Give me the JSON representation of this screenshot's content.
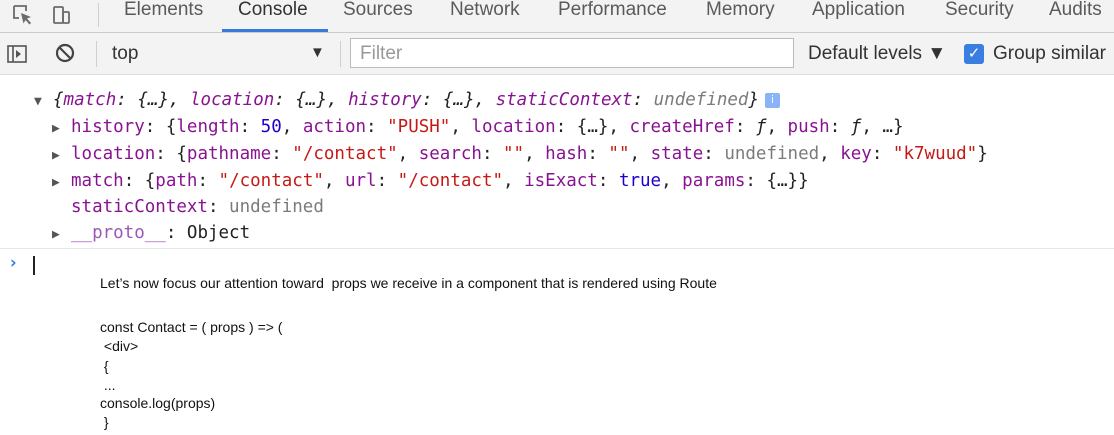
{
  "devtools": {
    "tabs": [
      {
        "label": "Elements"
      },
      {
        "label": "Console"
      },
      {
        "label": "Sources"
      },
      {
        "label": "Network"
      },
      {
        "label": "Performance"
      },
      {
        "label": "Memory"
      },
      {
        "label": "Application"
      },
      {
        "label": "Security"
      },
      {
        "label": "Audits"
      }
    ],
    "active_tab": "Console",
    "accent_color": "#3879d9"
  },
  "toolbar": {
    "context": "top",
    "filter_placeholder": "Filter",
    "levels": "Default levels ▼",
    "group_similar": "Group similar",
    "group_similar_checked": true
  },
  "console": {
    "summary": {
      "open": "{",
      "k1": "match",
      "v1": "{…}",
      "k2": "location",
      "v2": "{…}",
      "k3": "history",
      "v3": "{…}",
      "k4": "staticContext",
      "v4": "undefined",
      "close": "}"
    },
    "history": {
      "key": "history",
      "length_key": "length",
      "length_val": "50",
      "action_key": "action",
      "action_val": "\"PUSH\"",
      "location_key": "location",
      "location_val": "{…}",
      "createHref_key": "createHref",
      "createHref_val": "ƒ",
      "push_key": "push",
      "push_val": "ƒ",
      "more": "…"
    },
    "location": {
      "key": "location",
      "pathname_key": "pathname",
      "pathname_val": "\"/contact\"",
      "search_key": "search",
      "search_val": "\"\"",
      "hash_key": "hash",
      "hash_val": "\"\"",
      "state_key": "state",
      "state_val": "undefined",
      "key_key": "key",
      "key_val": "\"k7wuud\""
    },
    "match": {
      "key": "match",
      "path_key": "path",
      "path_val": "\"/contact\"",
      "url_key": "url",
      "url_val": "\"/contact\"",
      "isExact_key": "isExact",
      "isExact_val": "true",
      "params_key": "params",
      "params_val": "{…}"
    },
    "staticContext": {
      "key": "staticContext",
      "val": "undefined"
    },
    "proto": {
      "key": "__proto__",
      "val": "Object"
    },
    "prompt": "›"
  },
  "notes": [
    "Let’s now focus our attention toward  props we receive in a component that is rendered using Route",
    "const Contact = ( props ) => (",
    " <div>",
    " {",
    " ...",
    "console.log(props)",
    " }"
  ]
}
